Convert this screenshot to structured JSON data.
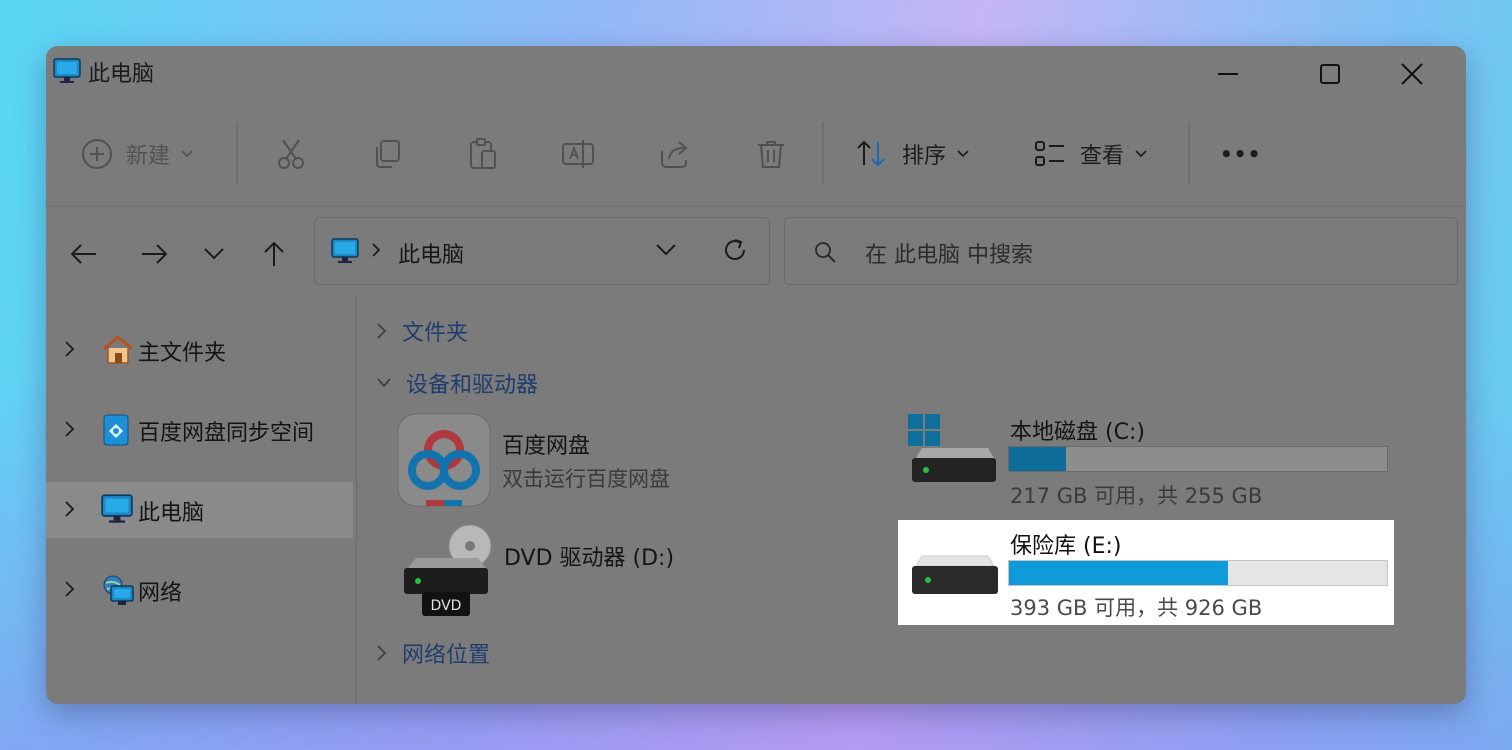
{
  "window": {
    "title": "此电脑"
  },
  "toolbar": {
    "new_label": "新建",
    "sort_label": "排序",
    "view_label": "查看",
    "more_label": "•••"
  },
  "address": {
    "path": "此电脑"
  },
  "search": {
    "placeholder": "在 此电脑 中搜索"
  },
  "sidebar": {
    "items": [
      {
        "label": "主文件夹"
      },
      {
        "label": "百度网盘同步空间"
      },
      {
        "label": "此电脑"
      },
      {
        "label": "网络"
      }
    ]
  },
  "main": {
    "groups": {
      "folders": "文件夹",
      "devices": "设备和驱动器",
      "network_locations": "网络位置"
    },
    "tiles": {
      "baidu": {
        "title": "百度网盘",
        "subtitle": "双击运行百度网盘"
      },
      "dvd": {
        "title": "DVD 驱动器 (D:)",
        "badge": "DVD"
      },
      "c_drive": {
        "title": "本地磁盘 (C:)",
        "usage": "217 GB 可用，共 255 GB",
        "used_fraction": 0.15
      },
      "e_drive": {
        "title": "保险库 (E:)",
        "usage": "393 GB 可用，共 926 GB",
        "used_fraction": 0.58
      }
    }
  },
  "colors": {
    "accent": "#0f9ad9",
    "dim_accent": "#0d6d98",
    "group_header": "#1f3d6e"
  },
  "icons": [
    "pc-icon",
    "minimize-icon",
    "maximize-icon",
    "close-icon",
    "plus-circle-icon",
    "chevron-down-icon",
    "cut-icon",
    "copy-icon",
    "paste-icon",
    "rename-icon",
    "share-icon",
    "delete-icon",
    "sort-icon",
    "view-icon",
    "more-icon",
    "back-icon",
    "forward-icon",
    "up-icon",
    "refresh-icon",
    "search-icon",
    "home-icon",
    "baidu-sync-icon",
    "network-icon",
    "chevron-right-icon",
    "baidu-app-icon",
    "dvd-drive-icon",
    "windows-drive-icon",
    "drive-icon"
  ]
}
